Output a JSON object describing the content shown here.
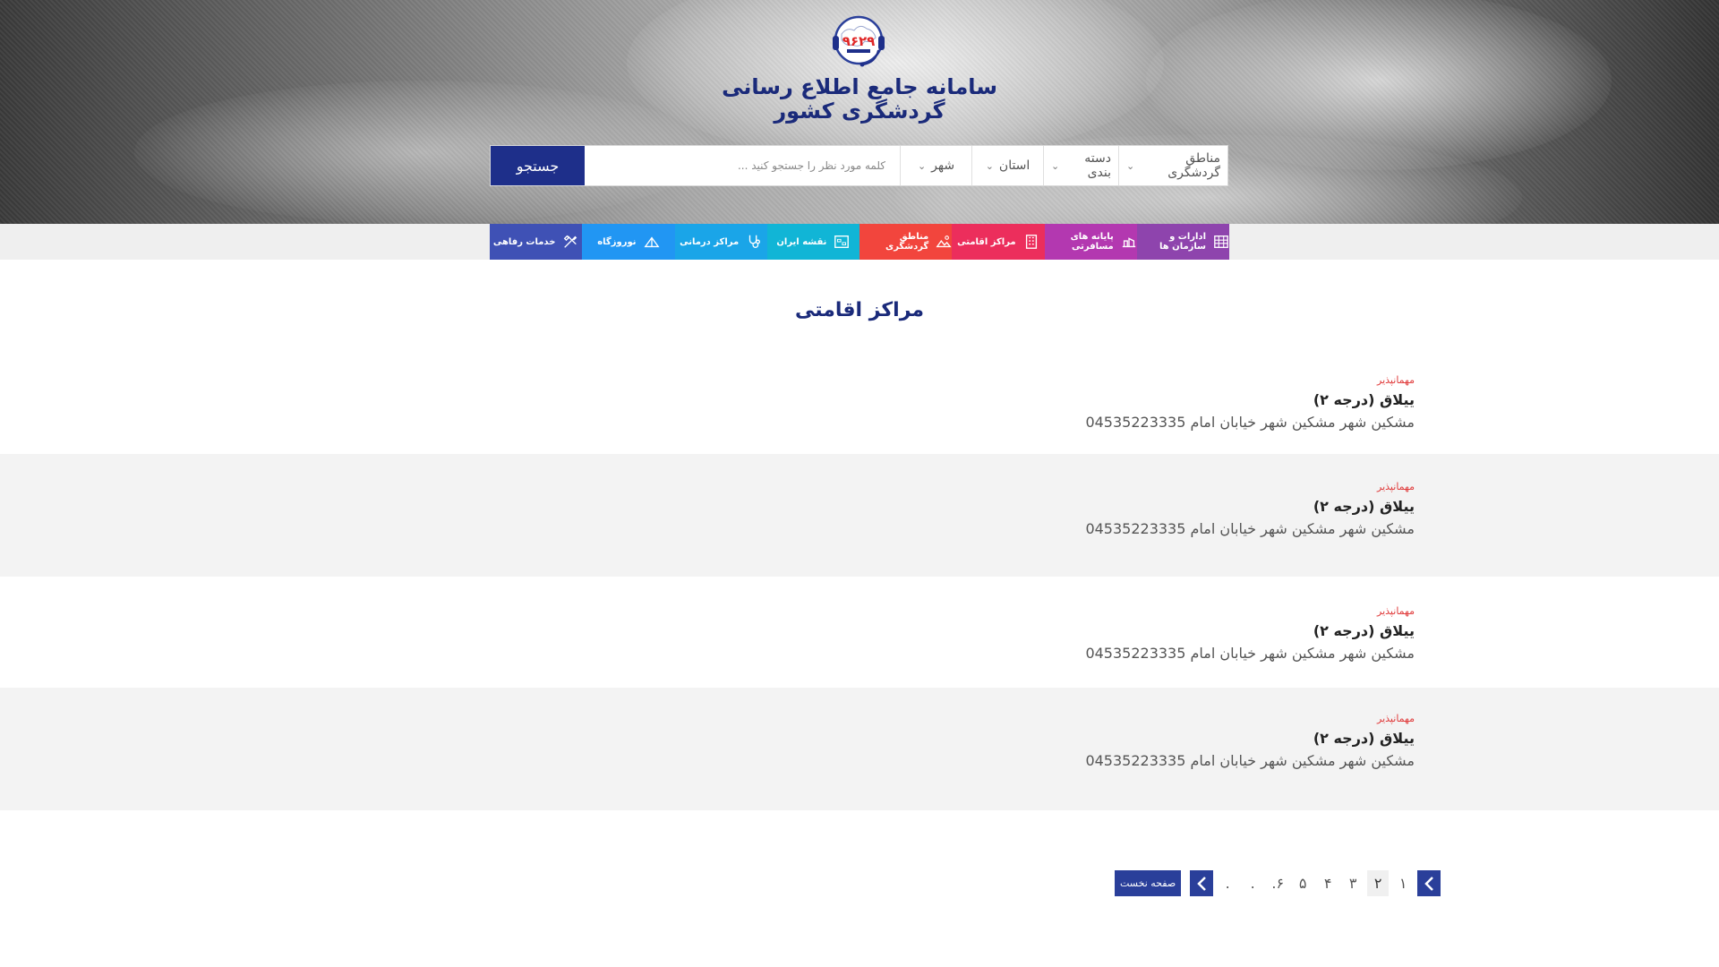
{
  "header": {
    "site_title_line1": "سامانه جامع اطلاع رسانی",
    "site_title_line2": "گردشگری کشور",
    "logo_number": "۹۶۲۹"
  },
  "search": {
    "dropdowns": [
      "مناطق گردشگری",
      "دسته بندی",
      "استان",
      "شهر"
    ],
    "placeholder": "کلمه مورد نظر را جستجو کنید ...",
    "button_label": "جستجو"
  },
  "categories": [
    {
      "label": "ادارات و سازمان ها",
      "color": "#8e44ad",
      "icon": "building-icon"
    },
    {
      "label": "پایانه های مسافرتی",
      "color": "#b338b0",
      "icon": "terminal-icon"
    },
    {
      "label": "مراکز اقامتی",
      "color": "#ec2e5c",
      "icon": "hotel-icon"
    },
    {
      "label": "مناطق گردشگری",
      "color": "#f2453d",
      "icon": "landscape-icon"
    },
    {
      "label": "نقشه ایران",
      "color": "#11b5d6",
      "icon": "map-icon"
    },
    {
      "label": "مراکز درمانی",
      "color": "#1aa5e8",
      "icon": "stethoscope-icon"
    },
    {
      "label": "نوروزگاه",
      "color": "#2196f3",
      "icon": "tent-icon"
    },
    {
      "label": "خدمات رفاهی",
      "color": "#3f51b5",
      "icon": "tools-icon"
    }
  ],
  "page_heading": "مراکز اقامتی",
  "listings": [
    {
      "category": "مهمانپذیر",
      "title": "ییلاق (درجه ۲)",
      "address": "مشکین شهر مشکین شهر خیابان امام 04535223335"
    },
    {
      "category": "مهمانپذیر",
      "title": "ییلاق (درجه ۲)",
      "address": "مشکین شهر مشکین شهر خیابان امام 04535223335"
    },
    {
      "category": "مهمانپذیر",
      "title": "ییلاق (درجه ۲)",
      "address": "مشکین شهر مشکین شهر خیابان امام 04535223335"
    },
    {
      "category": "مهمانپذیر",
      "title": "ییلاق (درجه ۲)",
      "address": "مشکین شهر مشکین شهر خیابان امام 04535223335"
    }
  ],
  "pagination": {
    "pages": [
      "۱",
      "۲",
      "۳",
      "۴",
      "۵",
      "۶.",
      ".",
      "."
    ],
    "active_page": "۲",
    "first_page_label": "صفحه نخست"
  }
}
